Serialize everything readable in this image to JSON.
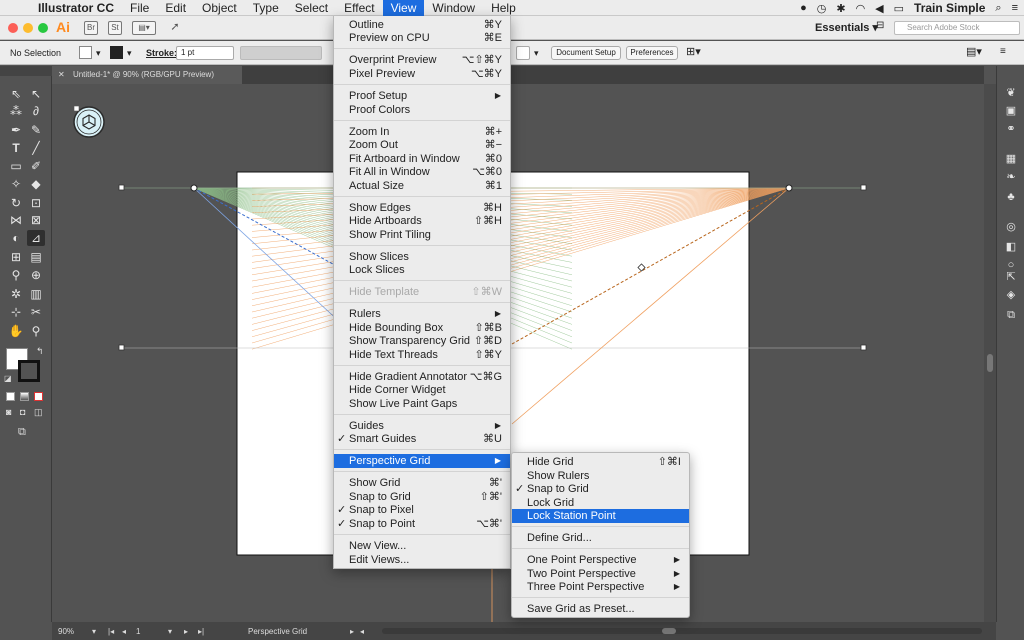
{
  "menubar": {
    "app_name": "Illustrator CC",
    "items": [
      "File",
      "Edit",
      "Object",
      "Type",
      "Select",
      "Effect",
      "View",
      "Window",
      "Help"
    ],
    "active": "View",
    "user": "Train Simple"
  },
  "appbar": {
    "logo": "Ai",
    "br": "Br",
    "st": "St",
    "workspace": "Essentials",
    "search_placeholder": "Search Adobe Stock"
  },
  "controlbar": {
    "selection": "No Selection",
    "stroke_label": "Stroke:",
    "stroke_value": "1 pt",
    "document_setup": "Document Setup",
    "preferences": "Preferences"
  },
  "document": {
    "tab_title": "Untitled-1* @ 90% (RGB/GPU Preview)"
  },
  "statusbar": {
    "zoom": "90%",
    "artboard": "1",
    "tool": "Perspective Grid"
  },
  "view_menu": {
    "items": [
      {
        "label": "Outline",
        "shortcut": "⌘Y"
      },
      {
        "label": "Preview on CPU",
        "shortcut": "⌘E"
      },
      {
        "label": "Overprint Preview",
        "shortcut": "⌥⇧⌘Y"
      },
      {
        "label": "Pixel Preview",
        "shortcut": "⌥⌘Y"
      },
      {
        "label": "Proof Setup",
        "shortcut": ""
      },
      {
        "label": "Proof Colors",
        "shortcut": ""
      },
      {
        "label": "Zoom In",
        "shortcut": "⌘+"
      },
      {
        "label": "Zoom Out",
        "shortcut": "⌘−"
      },
      {
        "label": "Fit Artboard in Window",
        "shortcut": "⌘0"
      },
      {
        "label": "Fit All in Window",
        "shortcut": "⌥⌘0"
      },
      {
        "label": "Actual Size",
        "shortcut": "⌘1"
      },
      {
        "label": "Show Edges",
        "shortcut": "⌘H"
      },
      {
        "label": "Hide Artboards",
        "shortcut": "⇧⌘H"
      },
      {
        "label": "Show Print Tiling",
        "shortcut": ""
      },
      {
        "label": "Show Slices",
        "shortcut": ""
      },
      {
        "label": "Lock Slices",
        "shortcut": ""
      },
      {
        "label": "Hide Template",
        "shortcut": "⇧⌘W"
      },
      {
        "label": "Rulers",
        "shortcut": ""
      },
      {
        "label": "Hide Bounding Box",
        "shortcut": "⇧⌘B"
      },
      {
        "label": "Show Transparency Grid",
        "shortcut": "⇧⌘D"
      },
      {
        "label": "Hide Text Threads",
        "shortcut": "⇧⌘Y"
      },
      {
        "label": "Hide Gradient Annotator",
        "shortcut": "⌥⌘G"
      },
      {
        "label": "Hide Corner Widget",
        "shortcut": ""
      },
      {
        "label": "Show Live Paint Gaps",
        "shortcut": ""
      },
      {
        "label": "Guides",
        "shortcut": ""
      },
      {
        "label": "Smart Guides",
        "shortcut": "⌘U"
      },
      {
        "label": "Perspective Grid",
        "shortcut": ""
      },
      {
        "label": "Show Grid",
        "shortcut": "⌘'"
      },
      {
        "label": "Snap to Grid",
        "shortcut": "⇧⌘'"
      },
      {
        "label": "Snap to Pixel",
        "shortcut": ""
      },
      {
        "label": "Snap to Point",
        "shortcut": "⌥⌘'"
      },
      {
        "label": "New View...",
        "shortcut": ""
      },
      {
        "label": "Edit Views...",
        "shortcut": ""
      }
    ]
  },
  "perspective_menu": {
    "items": [
      {
        "label": "Hide Grid",
        "shortcut": "⇧⌘I"
      },
      {
        "label": "Show Rulers",
        "shortcut": ""
      },
      {
        "label": "Snap to Grid",
        "shortcut": ""
      },
      {
        "label": "Lock Grid",
        "shortcut": ""
      },
      {
        "label": "Lock Station Point",
        "shortcut": ""
      },
      {
        "label": "Define Grid...",
        "shortcut": ""
      },
      {
        "label": "One Point Perspective",
        "shortcut": ""
      },
      {
        "label": "Two Point Perspective",
        "shortcut": ""
      },
      {
        "label": "Three Point Perspective",
        "shortcut": ""
      },
      {
        "label": "Save Grid as Preset...",
        "shortcut": ""
      }
    ]
  },
  "colors": {
    "menu_highlight": "#1d6de0",
    "left_grid": "#8fc08a",
    "right_grid": "#f0a060",
    "ai_orange": "#ff8a1f"
  }
}
